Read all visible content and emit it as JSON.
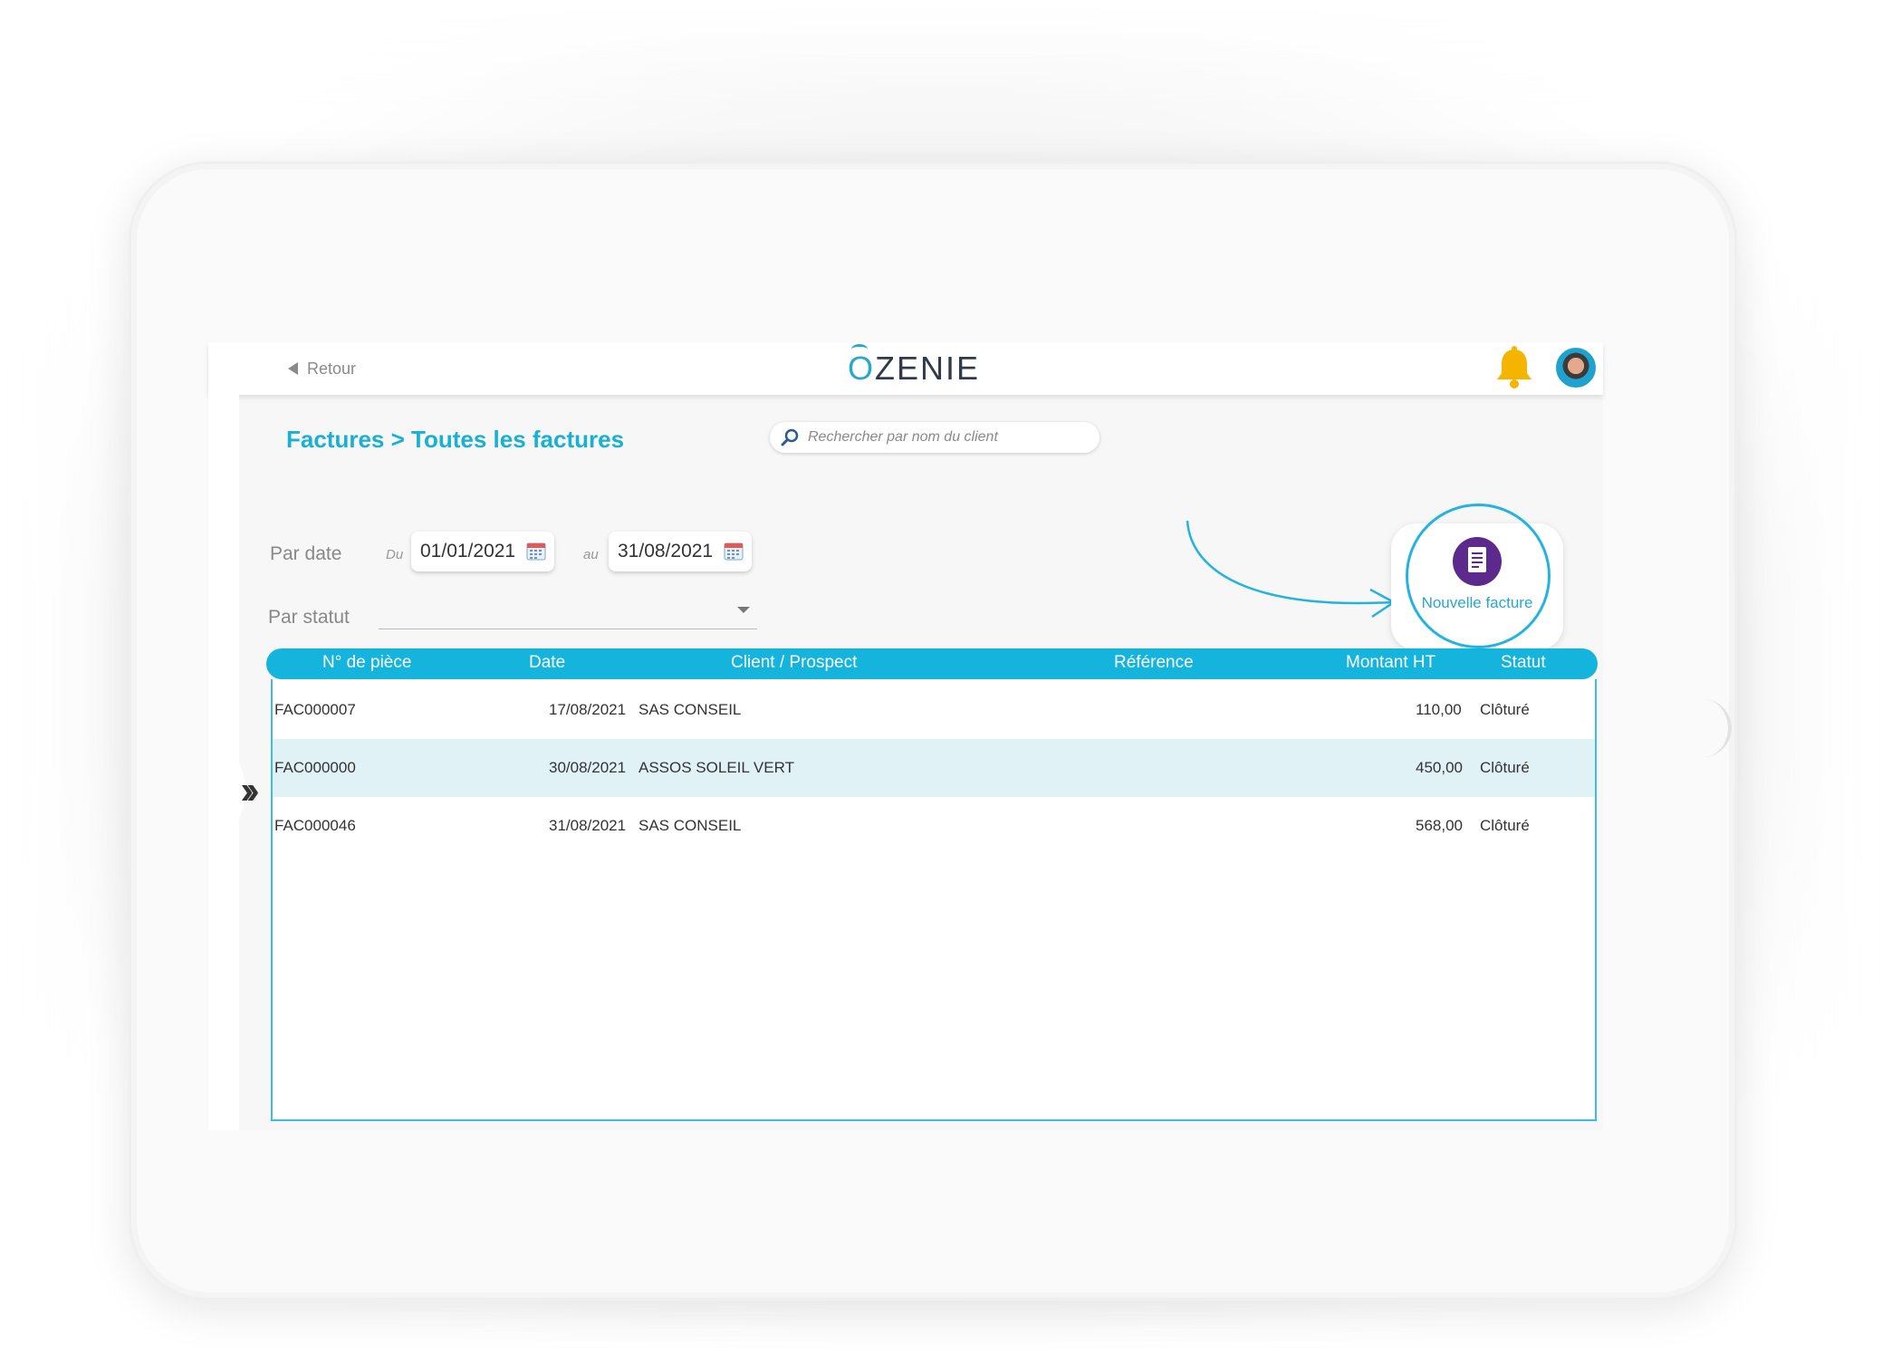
{
  "header": {
    "back_label": "Retour",
    "logo_first": "O",
    "logo_rest": "ZENIE"
  },
  "page": {
    "breadcrumb": "Factures > Toutes les factures"
  },
  "search": {
    "placeholder": "Rechercher par nom du client"
  },
  "filters": {
    "date_label": "Par date",
    "from_label": "Du",
    "from_value": "01/01/2021",
    "to_label": "au",
    "to_value": "31/08/2021",
    "status_label": "Par statut",
    "status_value": ""
  },
  "new_invoice": {
    "label": "Nouvelle facture"
  },
  "table": {
    "columns": [
      "N° de pièce",
      "Date",
      "Client / Prospect",
      "Référence",
      "Montant HT",
      "Statut"
    ],
    "rows": [
      {
        "piece": "FAC000007",
        "date": "17/08/2021",
        "client": "SAS CONSEIL",
        "reference": "",
        "montant": "110,00",
        "statut": "Clôturé"
      },
      {
        "piece": "FAC000000",
        "date": "30/08/2021",
        "client": "ASSOS SOLEIL VERT",
        "reference": "",
        "montant": "450,00",
        "statut": "Clôturé"
      },
      {
        "piece": "FAC000046",
        "date": "31/08/2021",
        "client": "SAS CONSEIL",
        "reference": "",
        "montant": "568,00",
        "statut": "Clôturé"
      }
    ]
  },
  "colors": {
    "accent": "#14b4dd",
    "title": "#1ab0d4",
    "row_highlight": "#e1f2f6",
    "bell": "#f5b400"
  },
  "icons": {
    "back": "triangle-left-icon",
    "bell": "bell-icon",
    "search": "magnifier-icon",
    "calendar": "calendar-icon",
    "new_invoice": "document-icon",
    "expand": "double-chevron-right-icon"
  }
}
